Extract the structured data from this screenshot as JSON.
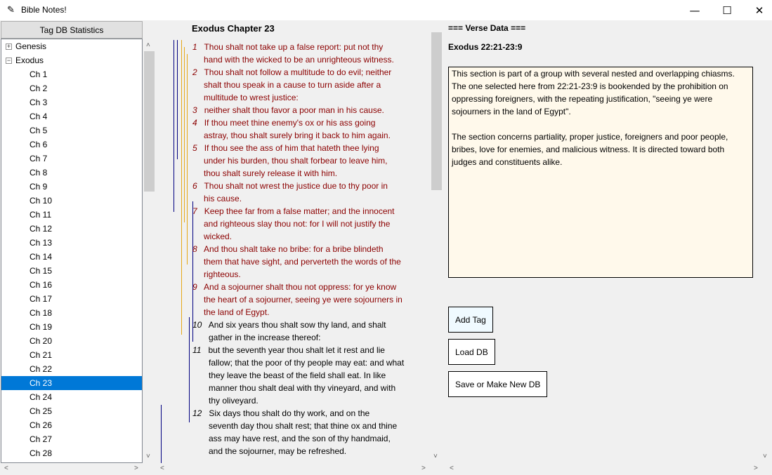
{
  "window": {
    "title": "Bible Notes!",
    "min_glyph": "—",
    "max_glyph": "☐",
    "close_glyph": "✕",
    "app_icon": "feather-icon"
  },
  "sidebar": {
    "stats_button": "Tag DB Statistics",
    "books": [
      {
        "label": "Genesis",
        "expander": "+"
      },
      {
        "label": "Exodus",
        "expander": "−"
      }
    ],
    "chapters": [
      "Ch 1",
      "Ch 2",
      "Ch 3",
      "Ch 4",
      "Ch 5",
      "Ch 6",
      "Ch 7",
      "Ch 8",
      "Ch 9",
      "Ch 10",
      "Ch 11",
      "Ch 12",
      "Ch 13",
      "Ch 14",
      "Ch 15",
      "Ch 16",
      "Ch 17",
      "Ch 18",
      "Ch 19",
      "Ch 20",
      "Ch 21",
      "Ch 22",
      "Ch 23",
      "Ch 24",
      "Ch 25",
      "Ch 26",
      "Ch 27",
      "Ch 28"
    ],
    "selected_chapter": "Ch 23"
  },
  "verses": {
    "chapter_title": "Exodus Chapter 23",
    "items": [
      {
        "num": "1",
        "lines": [
          "Thou shalt not take up a false report: put not thy",
          "hand with the wicked to be an unrighteous witness."
        ],
        "highlight": true
      },
      {
        "num": "2",
        "lines": [
          "Thou shalt not follow a multitude to do evil; neither",
          "shalt thou speak in a cause to turn aside after a",
          "multitude to wrest justice:"
        ],
        "highlight": true
      },
      {
        "num": "3",
        "lines": [
          "neither shalt thou favor a poor man in his cause."
        ],
        "highlight": true
      },
      {
        "num": "4",
        "lines": [
          "If thou meet thine enemy's ox or his ass going",
          "astray, thou shalt surely bring it back to him again."
        ],
        "highlight": true
      },
      {
        "num": "5",
        "lines": [
          "If thou see the ass of him that hateth thee lying",
          "under his burden, thou shalt forbear to leave him,",
          "thou shalt surely release it with him."
        ],
        "highlight": true
      },
      {
        "num": "6",
        "lines": [
          "Thou shalt not wrest the justice due to thy poor in",
          "his cause."
        ],
        "highlight": true
      },
      {
        "num": "7",
        "lines": [
          "Keep thee far from a false matter; and the innocent",
          "and righteous slay thou not: for I will not justify the",
          "wicked."
        ],
        "highlight": true
      },
      {
        "num": "8",
        "lines": [
          "And thou shalt take no bribe: for a bribe blindeth",
          "them that have sight, and perverteth the words of the",
          "righteous."
        ],
        "highlight": true
      },
      {
        "num": "9",
        "lines": [
          "And a sojourner shalt thou not oppress: for ye know",
          "the heart of a sojourner, seeing ye were sojourners in",
          "the land of Egypt."
        ],
        "highlight": true
      },
      {
        "num": "10",
        "lines": [
          "And six years thou shalt sow thy land, and shalt",
          "gather in the increase thereof:"
        ],
        "highlight": false
      },
      {
        "num": "11",
        "lines": [
          "but the seventh year thou shalt let it rest and lie",
          "fallow; that the poor of thy people may eat: and what",
          "they leave the beast of the field shall eat. In like",
          "manner thou shalt deal with thy vineyard, and with",
          "thy oliveyard."
        ],
        "highlight": false
      },
      {
        "num": "12",
        "lines": [
          "Six days thou shalt do thy work, and on the",
          "seventh day thou shalt rest; that thine ox and thine",
          "ass may have rest, and the son of thy handmaid,",
          "and the sojourner, may be refreshed."
        ],
        "highlight": false
      }
    ],
    "highlight_color": "#8b0000"
  },
  "verse_data": {
    "header": "=== Verse Data ===",
    "reference": "Exodus 22:21-23:9",
    "note_p1": "This section is part of a group with several nested and overlapping chiasms. The one selected here from 22:21-23:9 is bookended by the prohibition on oppressing foreigners, with the repeating justification, \"seeing ye were sojourners in the land of Egypt\".",
    "note_p2": "The section concerns partiality, proper justice, foreigners and poor people, bribes, love for enemies, and malicious witness. It is directed toward both judges and constituents alike.",
    "note_bg": "#fff9eb"
  },
  "actions": {
    "add_tag": "Add Tag",
    "load_db": "Load DB",
    "save_db": "Save or Make New DB"
  },
  "colors": {
    "selection": "#0078d7",
    "tag_line_gold": "#e6a817",
    "tag_line_navy": "#000080"
  }
}
